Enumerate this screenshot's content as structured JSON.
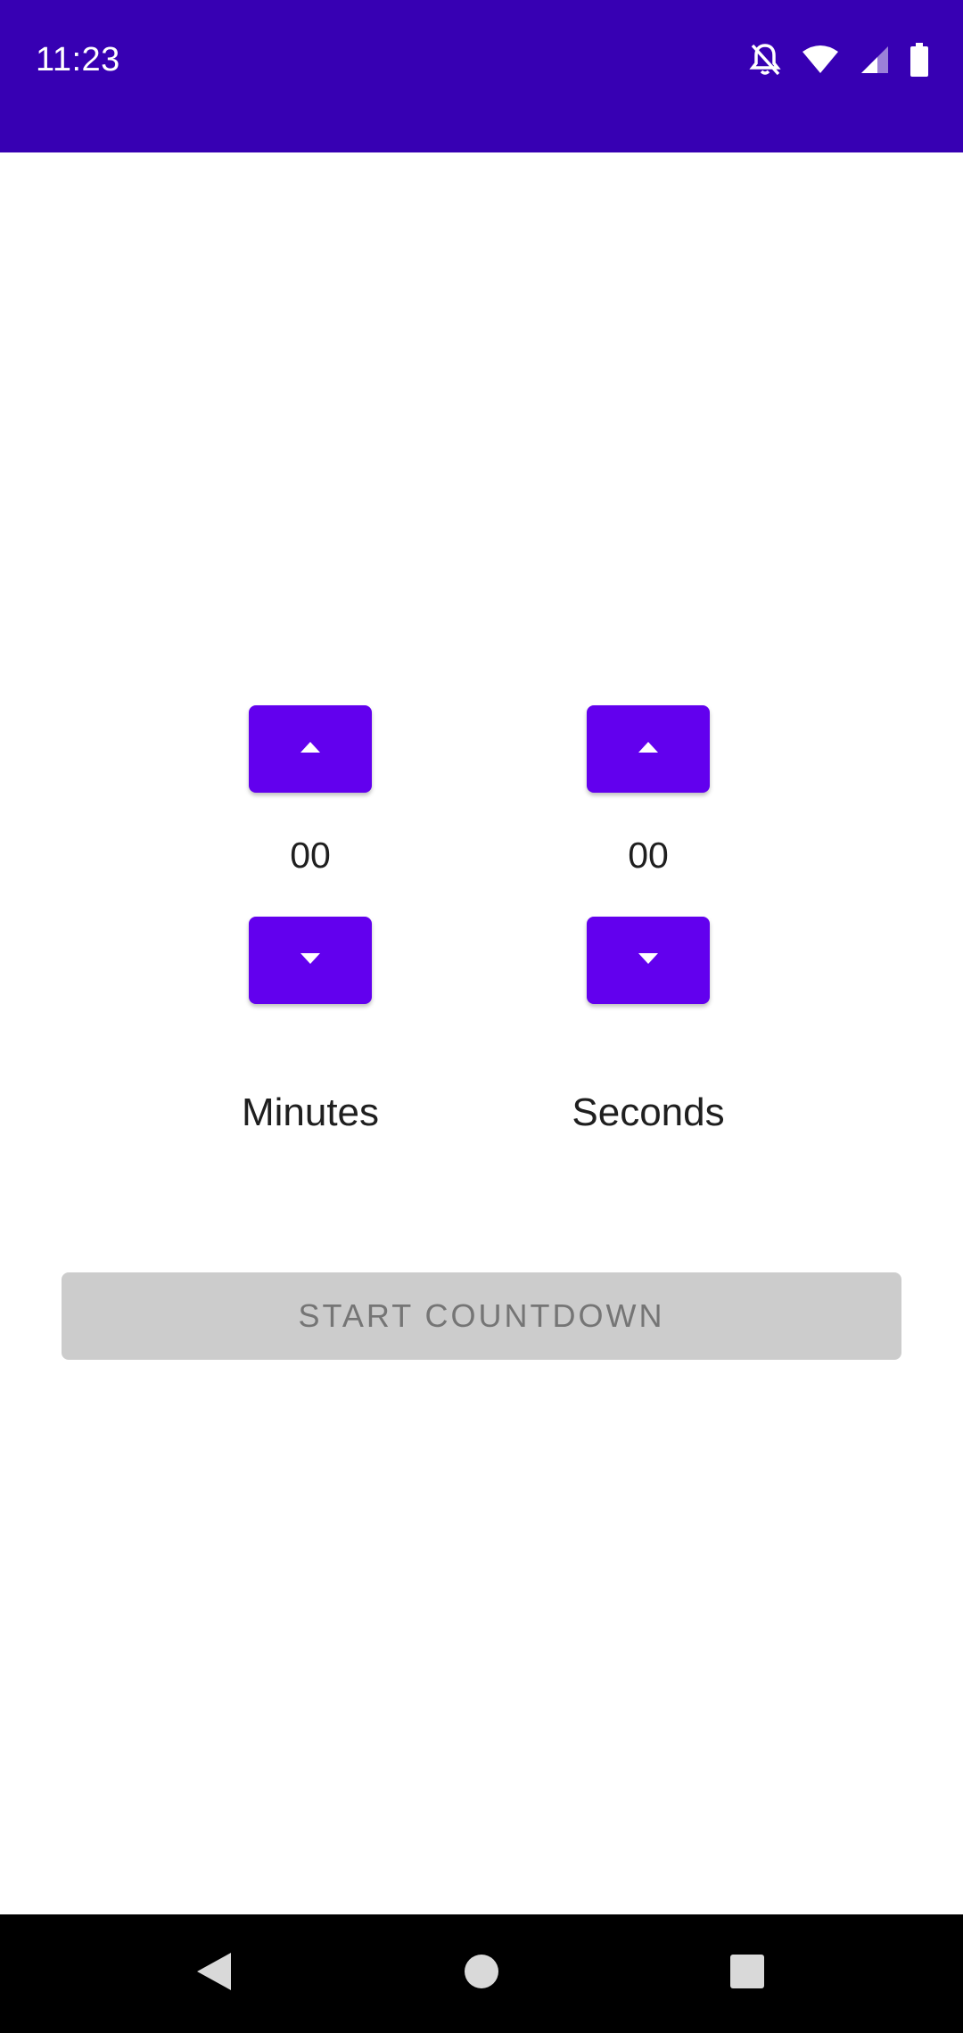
{
  "status_bar": {
    "time": "11:23",
    "background": "#3700b3",
    "icons": [
      "notifications-off-icon",
      "wifi-icon",
      "cell-signal-icon",
      "battery-icon"
    ]
  },
  "timer": {
    "accent_color": "#6200ee",
    "minutes": {
      "value": "00",
      "label": "Minutes",
      "increment_icon": "arrow-up-icon",
      "decrement_icon": "arrow-down-icon"
    },
    "seconds": {
      "value": "00",
      "label": "Seconds",
      "increment_icon": "arrow-up-icon",
      "decrement_icon": "arrow-down-icon"
    }
  },
  "start_button": {
    "label": "START COUNTDOWN",
    "enabled": false
  },
  "nav_bar": {
    "icons": [
      "back-icon",
      "home-icon",
      "recents-icon"
    ]
  }
}
